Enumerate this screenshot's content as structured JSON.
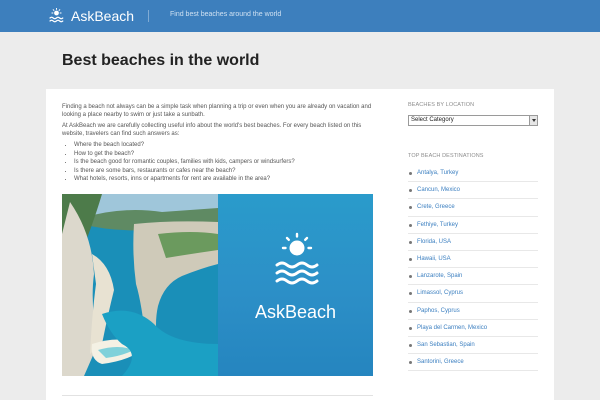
{
  "header": {
    "logo_text": "AskBeach",
    "tagline": "Find best beaches around the world",
    "bg_color": "#3d7fbd"
  },
  "page_title": "Best beaches in the world",
  "content": {
    "intro": "Finding a beach not always can be a simple task when planning a trip or even when you are already on vacation and looking a place nearby to swim or just take a sunbath.",
    "lead": "At AskBeach we are carefully collecting useful info about the world's best beaches. For every beach listed on this website, travelers can find such answers as:",
    "questions": [
      "Where the beach located?",
      "How to get the beach?",
      "Is the beach good for romantic couples, families with kids, campers or windsurfers?",
      "Is there are some bars, restaurants or cafes near the beach?",
      "What hotels, resorts, inns or apartments for rent are available in the area?"
    ],
    "hero_brand": "AskBeach",
    "hero_icon": "sun-over-waves-icon"
  },
  "sidebar": {
    "location_title": "BEACHES BY LOCATION",
    "select_value": "Select Category",
    "destinations_title": "TOP BEACH DESTINATIONS",
    "destinations": [
      "Antalya, Turkey",
      "Cancun, Mexico",
      "Crete, Greece",
      "Fethiye, Turkey",
      "Florida, USA",
      "Hawaii, USA",
      "Lanzarote, Spain",
      "Limassol, Cyprus",
      "Paphos, Cyprus",
      "Playa del Carmen, Mexico",
      "San Sebastian, Spain",
      "Santorini, Greece"
    ],
    "link_color": "#3b7fc0"
  }
}
